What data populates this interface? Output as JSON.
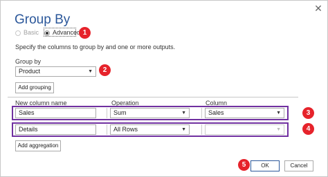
{
  "dialog": {
    "title": "Group By",
    "close_icon": "close-icon",
    "mode_basic": "Basic",
    "mode_advanced": "Advanced",
    "selected_mode": "Advanced",
    "description": "Specify the columns to group by and one or more outputs.",
    "group_by_label": "Group by",
    "group_by_value": "Product",
    "add_grouping_label": "Add grouping",
    "columns": {
      "new_column_name": "New column name",
      "operation": "Operation",
      "column": "Column"
    },
    "rows": [
      {
        "name": "Sales",
        "operation": "Sum",
        "column": "Sales"
      },
      {
        "name": "Details",
        "operation": "All Rows",
        "column": ""
      }
    ],
    "add_aggregation_label": "Add aggregation",
    "ok_label": "OK",
    "cancel_label": "Cancel"
  },
  "annotations": [
    "1",
    "2",
    "3",
    "4",
    "5"
  ],
  "colors": {
    "title": "#2b579a",
    "highlight": "#7030a0",
    "badge": "#e6232b"
  }
}
